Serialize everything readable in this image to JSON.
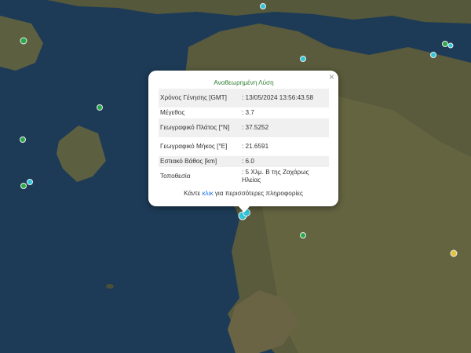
{
  "map": {
    "colors": {
      "sea": "#1d3b57",
      "land": "#5a5a3c",
      "popup_title": "#2e7d32",
      "link": "#1a73e8"
    },
    "markers": [
      {
        "label": "green-marker",
        "color": "#2ba84a"
      },
      {
        "label": "cyan-marker",
        "color": "#30c6d9"
      },
      {
        "label": "yellow-marker",
        "color": "#e3c33c"
      }
    ]
  },
  "popup": {
    "title": "Αναθεωρημένη Λύση",
    "rows": [
      {
        "key": "Χρόνος Γένησης [GMT]",
        "value": ": 13/05/2024 13:56:43.58"
      },
      {
        "key": "Μέγεθος",
        "value": ": 3.7"
      },
      {
        "key": "Γεωγραφικό Πλάτος [°N]",
        "value": ": 37.5252"
      },
      {
        "key": "Γεωγραφικό Μήκος [°E]",
        "value": ": 21.6591"
      },
      {
        "key": "Εστιακό Βάθος [km]",
        "value": ": 6.0"
      },
      {
        "key": "Τοποθεσία",
        "value": ": 5 Χλμ. Β της Ζαχάρως Ηλείας"
      }
    ],
    "more_prefix": "Κάντε ",
    "more_link": "κλικ",
    "more_suffix": " για περισσότερες πληροφορίες",
    "close_label": "×"
  }
}
